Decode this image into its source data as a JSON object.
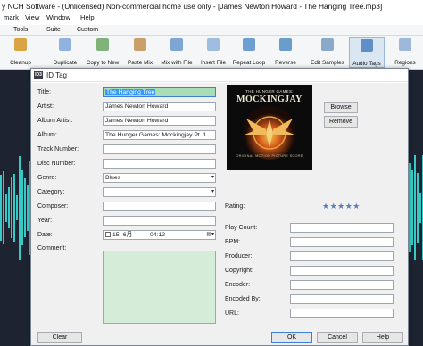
{
  "app": {
    "title": "y NCH Software - (Unlicensed) Non-commercial home use only - [James Newton Howard - The Hanging Tree.mp3]",
    "menu": [
      "mark",
      "View",
      "Window",
      "Help"
    ],
    "tabs": [
      "Tools",
      "Suite",
      "Custom"
    ],
    "toolbar": [
      {
        "label": "Cleanup",
        "icon": "broom-icon"
      },
      {
        "label": "Duplicate",
        "icon": "duplicate-icon"
      },
      {
        "label": "Copy to New",
        "icon": "copy-to-new-icon"
      },
      {
        "label": "Paste Mix",
        "icon": "paste-mix-icon"
      },
      {
        "label": "Mix with File",
        "icon": "mix-with-file-icon"
      },
      {
        "label": "Insert File",
        "icon": "insert-file-icon"
      },
      {
        "label": "Repeat Loop",
        "icon": "repeat-loop-icon"
      },
      {
        "label": "Reverse",
        "icon": "reverse-icon"
      },
      {
        "label": "Edit Samples",
        "icon": "edit-samples-icon"
      },
      {
        "label": "Audio Tags",
        "icon": "audio-tags-icon"
      },
      {
        "label": "Regions",
        "icon": "regions-icon"
      }
    ],
    "waveform_color": "#36c9c6",
    "waveform_bg": "#1d2330"
  },
  "dialog": {
    "icon_text": "ID3",
    "title": "ID Tag",
    "fields": {
      "title": {
        "label": "Title:",
        "value": "The Hanging Tree"
      },
      "artist": {
        "label": "Artist:",
        "value": "James Newton Howard"
      },
      "album_artist": {
        "label": "Album Artist:",
        "value": "James Newton Howard"
      },
      "album": {
        "label": "Album:",
        "value": "The Hunger Games: Mockingjay Pt. 1"
      },
      "track_number": {
        "label": "Track Number:",
        "value": ""
      },
      "disc_number": {
        "label": "Disc Number:",
        "value": ""
      },
      "genre": {
        "label": "Genre:",
        "value": "Blues"
      },
      "category": {
        "label": "Category:",
        "value": ""
      },
      "composer": {
        "label": "Composer:",
        "value": ""
      },
      "year": {
        "label": "Year:",
        "value": ""
      },
      "date": {
        "label": "Date:",
        "value": "15- 6月",
        "time": "04:12"
      },
      "comment": {
        "label": "Comment:",
        "value": ""
      }
    },
    "artwork": {
      "line1": "THE HUNGER GAMES:",
      "line2": "MOCKINGJAY",
      "line3": "ORIGINAL MOTION PICTURE SCORE"
    },
    "browse_label": "Browse",
    "remove_label": "Remove",
    "rating": {
      "label": "Rating:",
      "value": 5,
      "max": 5,
      "star_color": "#5b7fb3"
    },
    "right_fields": [
      {
        "label": "Play Count:",
        "value": ""
      },
      {
        "label": "BPM:",
        "value": ""
      },
      {
        "label": "Producer:",
        "value": ""
      },
      {
        "label": "Copyright:",
        "value": ""
      },
      {
        "label": "Encoder:",
        "value": ""
      },
      {
        "label": "Encoded By:",
        "value": ""
      },
      {
        "label": "URL:",
        "value": ""
      }
    ],
    "clear_label": "Clear",
    "ok_label": "OK",
    "cancel_label": "Cancel",
    "help_label": "Help"
  }
}
